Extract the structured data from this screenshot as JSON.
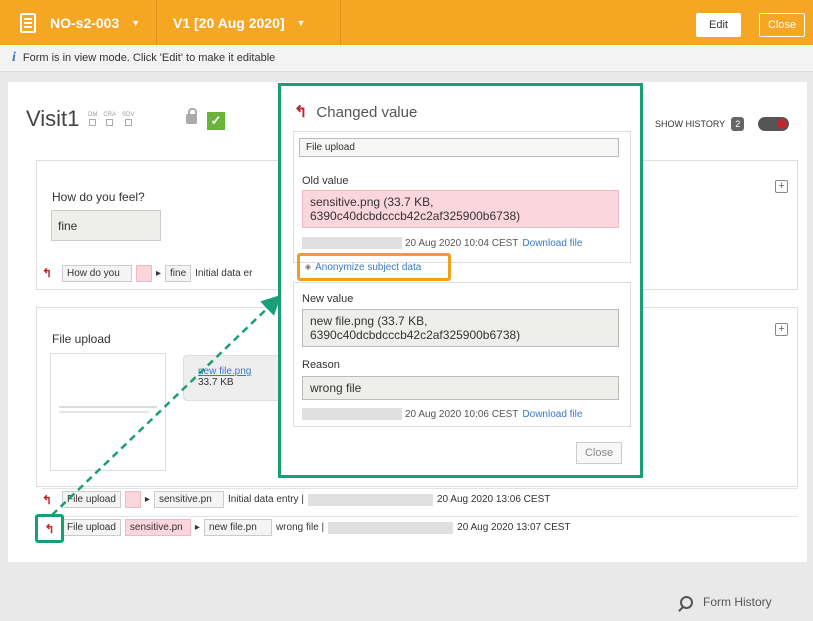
{
  "topbar": {
    "subject": "NO-s2-003",
    "version": "V1 [20 Aug 2020]",
    "edit": "Edit",
    "close": "Close"
  },
  "info": "Form is in view mode. Click 'Edit' to make it editable",
  "form": {
    "title": "Visit1",
    "flags": [
      "DM",
      "CRA",
      "SDV"
    ],
    "show_history": "SHOW HISTORY",
    "history_count": "2"
  },
  "q1": {
    "label": "How do you feel?",
    "value": "fine",
    "hist": {
      "field": "How do you",
      "new": "fine",
      "reason": "Initial data er"
    }
  },
  "q2": {
    "label": "File upload",
    "file_name": "new file.png",
    "file_size": "33.7 KB",
    "hist": [
      {
        "field": "File upload",
        "new": "sensitive.pn",
        "reason": "Initial data entry |",
        "date": "20 Aug 2020 13:06 CEST"
      },
      {
        "field": "File upload",
        "old": "sensitive.pn",
        "new": "new file.pn",
        "reason": "wrong file |",
        "date": "20 Aug 2020 13:07 CEST"
      }
    ]
  },
  "popup": {
    "title": "Changed value",
    "field": "File upload",
    "old_label": "Old value",
    "old_value": "sensitive.png (33.7 KB, 6390c40dcbdcccb42c2af325900b6738)",
    "old_date": "20 Aug 2020 10:04 CEST",
    "download": "Download file",
    "anon": "Anonymize subject data",
    "new_label": "New value",
    "new_value": "new file.png (33.7 KB, 6390c40dcbdcccb42c2af325900b6738)",
    "reason_label": "Reason",
    "reason": "wrong file",
    "new_date": "20 Aug 2020 10:06 CEST",
    "close": "Close"
  },
  "footer": {
    "form_history": "Form History"
  },
  "colors": {
    "accent": "#f5a623",
    "highlight": "#1a9e78",
    "anon_highlight": "#f0a020",
    "removed": "#fcd6dd"
  }
}
